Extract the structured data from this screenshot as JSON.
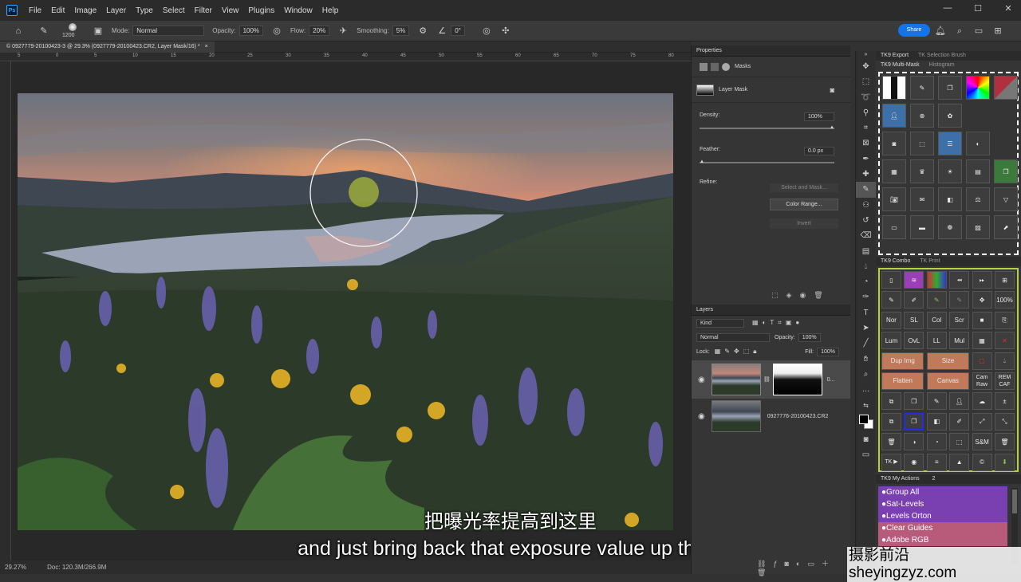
{
  "menubar": {
    "logo": "Ps",
    "items": [
      "File",
      "Edit",
      "Image",
      "Layer",
      "Type",
      "Select",
      "Filter",
      "View",
      "Plugins",
      "Window",
      "Help"
    ],
    "window_controls": [
      "—",
      "☐",
      "✕"
    ]
  },
  "options": {
    "brush_size": "1200",
    "mode_label": "Mode:",
    "mode": "Normal",
    "opacity_label": "Opacity:",
    "opacity": "100%",
    "flow_label": "Flow:",
    "flow": "20%",
    "smoothing_label": "Smoothing:",
    "smoothing": "5%",
    "angle": "0°",
    "share": "Share"
  },
  "document": {
    "tab": "© 0927779-20100423-3 @ 29.3% (0927779-20100423.CR2, Layer Mask/16) *",
    "zoom": "29.27%",
    "doc_size": "Doc: 120.3M/266.9M",
    "ruler_h": [
      "5",
      "0",
      "5",
      "10",
      "15",
      "20",
      "25",
      "30",
      "35",
      "40",
      "45",
      "50",
      "55",
      "60",
      "65",
      "70",
      "75",
      "80"
    ]
  },
  "subtitle": {
    "zh": "把曝光率提高到这里",
    "en": "and just bring back that exposure value up there"
  },
  "properties": {
    "title": "Properties",
    "tab": "Masks",
    "layer_mask": "Layer Mask",
    "density_label": "Density:",
    "density": "100%",
    "feather_label": "Feather:",
    "feather": "0.0 px",
    "refine_label": "Refine:",
    "select_mask": "Select and Mask...",
    "color_range": "Color Range...",
    "invert": "Invert"
  },
  "layers": {
    "title": "Layers",
    "kind": "Kind",
    "blend": "Normal",
    "opacity_label": "Opacity:",
    "opacity": "100%",
    "lock_label": "Lock:",
    "fill_label": "Fill:",
    "fill": "100%",
    "rows": [
      {
        "name": "0..."
      },
      {
        "name": "0927776-20100423.CR2"
      }
    ]
  },
  "tk": {
    "export_tab": "TK9 Export",
    "selection_tab": "TK Selection Brush",
    "multimask_tab": "TK9 Multi-Mask",
    "histogram_tab": "Histogram",
    "combo_tab": "TK9 Combo",
    "print_tab": "TK Print",
    "myactions_tab": "TK9 My Actions",
    "myactions_count": "2",
    "combo_labels": [
      "Nor",
      "SL",
      "Col",
      "Scr",
      "Lum",
      "OvL",
      "LL",
      "Mul",
      "Dup Img",
      "Size",
      "Flatten",
      "Canvas",
      "Cam Raw",
      "REM CAF",
      "S&M",
      "TK ▶",
      "100%"
    ],
    "actions": [
      "●Group All",
      "●Sat-Levels",
      "●Levels Orton",
      "●Clear Guides",
      "●Adobe RGB"
    ]
  },
  "watermark": "摄影前沿 sheyingzyz.com",
  "colors": {
    "accent": "#1473e6",
    "purple": "#7a3fb0",
    "pink": "#b85a7a"
  }
}
